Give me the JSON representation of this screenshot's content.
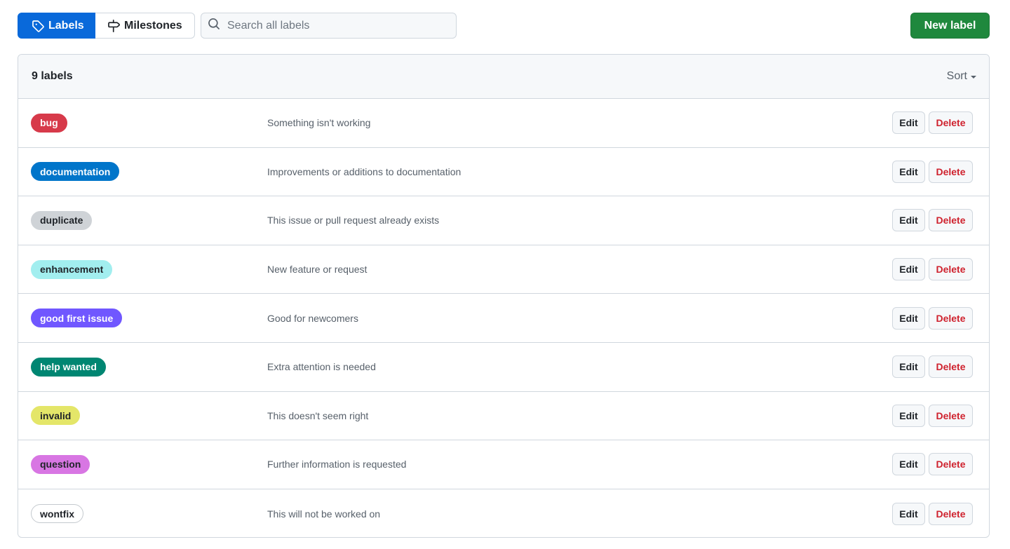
{
  "toolbar": {
    "labels_tab": "Labels",
    "milestones_tab": "Milestones",
    "search_placeholder": "Search all labels",
    "new_label_button": "New label"
  },
  "list": {
    "count_label": "9 labels",
    "sort_label": "Sort",
    "edit_label": "Edit",
    "delete_label": "Delete",
    "items": [
      {
        "name": "bug",
        "description": "Something isn't working",
        "bg": "#d73a4a",
        "fg": "#ffffff",
        "border": "#d73a4a"
      },
      {
        "name": "documentation",
        "description": "Improvements or additions to documentation",
        "bg": "#0075ca",
        "fg": "#ffffff",
        "border": "#0075ca"
      },
      {
        "name": "duplicate",
        "description": "This issue or pull request already exists",
        "bg": "#cfd3d7",
        "fg": "#1f2328",
        "border": "#cfd3d7"
      },
      {
        "name": "enhancement",
        "description": "New feature or request",
        "bg": "#a2eeef",
        "fg": "#1f2328",
        "border": "#a2eeef"
      },
      {
        "name": "good first issue",
        "description": "Good for newcomers",
        "bg": "#7057ff",
        "fg": "#ffffff",
        "border": "#7057ff"
      },
      {
        "name": "help wanted",
        "description": "Extra attention is needed",
        "bg": "#008672",
        "fg": "#ffffff",
        "border": "#008672"
      },
      {
        "name": "invalid",
        "description": "This doesn't seem right",
        "bg": "#e4e669",
        "fg": "#1f2328",
        "border": "#e4e669"
      },
      {
        "name": "question",
        "description": "Further information is requested",
        "bg": "#d876e3",
        "fg": "#1f2328",
        "border": "#d876e3"
      },
      {
        "name": "wontfix",
        "description": "This will not be worked on",
        "bg": "#ffffff",
        "fg": "#1f2328",
        "border": "#c4c9ce"
      }
    ]
  }
}
